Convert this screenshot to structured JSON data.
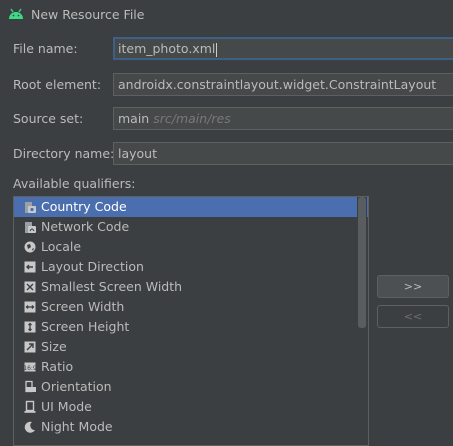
{
  "window": {
    "title": "New Resource File"
  },
  "form": {
    "file_name_label": "File name:",
    "file_name_value": "item_photo.xml",
    "root_element_label": "Root element:",
    "root_element_value": "androidx.constraintlayout.widget.ConstraintLayout",
    "source_set_label": "Source set:",
    "source_set_value": "main",
    "source_set_path": "src/main/res",
    "directory_name_label": "Directory name:",
    "directory_name_value": "layout",
    "available_qualifiers_label": "Available qualifiers:"
  },
  "qualifiers": {
    "selected_index": 0,
    "items": [
      {
        "label": "Country Code",
        "icon": "country-code-icon"
      },
      {
        "label": "Network Code",
        "icon": "network-code-icon"
      },
      {
        "label": "Locale",
        "icon": "globe-icon"
      },
      {
        "label": "Layout Direction",
        "icon": "layout-direction-icon"
      },
      {
        "label": "Smallest Screen Width",
        "icon": "smallest-width-icon"
      },
      {
        "label": "Screen Width",
        "icon": "screen-width-icon"
      },
      {
        "label": "Screen Height",
        "icon": "screen-height-icon"
      },
      {
        "label": "Size",
        "icon": "size-icon"
      },
      {
        "label": "Ratio",
        "icon": "ratio-icon"
      },
      {
        "label": "Orientation",
        "icon": "orientation-icon"
      },
      {
        "label": "UI Mode",
        "icon": "ui-mode-icon"
      },
      {
        "label": "Night Mode",
        "icon": "night-mode-icon"
      }
    ]
  },
  "buttons": {
    "add": ">>",
    "remove": "<<"
  }
}
